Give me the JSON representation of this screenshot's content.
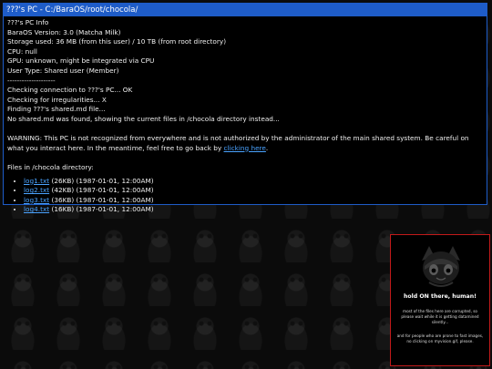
{
  "window": {
    "title": "???'s PC - C:/BaraOS/root/chocola/"
  },
  "info": {
    "heading": "???'s PC Info",
    "version": "BaraOS Version: 3.0 (Matcha Milk)",
    "storage": "Storage used: 36 MB (from this user) / 10 TB (from root directory)",
    "cpu": "CPU: null",
    "gpu": "GPU: unknown, might be integrated via CPU",
    "user_type": "User Type: Shared user (Member)",
    "separator": "--------------------"
  },
  "log": {
    "connecting": "Checking connection to ???'s PC... OK",
    "irregularities": "Checking for irregularities... X",
    "finding": "Finding ???'s shared.md file...",
    "not_found": "No shared.md was found, showing the current files in /chocola directory instead..."
  },
  "warning": {
    "text": "WARNING: This PC is not recognized from everywhere and is not authorized by the administrator of the main shared system. Be careful on what you interact here. In the meantime, feel free to go back by",
    "link_label": "clicking here",
    "suffix": "."
  },
  "files": {
    "heading": "Files in /chocola directory:",
    "items": [
      {
        "name": "log1.txt",
        "meta": "(26KB) (1987-01-01, 12:00AM)"
      },
      {
        "name": "log2.txt",
        "meta": "(42KB) (1987-01-01, 12:00AM)"
      },
      {
        "name": "log3.txt",
        "meta": "(36KB) (1987-01-01, 12:00AM)"
      },
      {
        "name": "log4.txt",
        "meta": "(16KB) (1987-01-01, 12:00AM)"
      }
    ]
  },
  "popup": {
    "title": "hold ON there, human!",
    "text1": "most of the files here are corrupted, so please wait while it is getting datamined silently...",
    "text2": "and for people who are prone to fast images, no clicking on myvision.gif, please."
  },
  "colors": {
    "accent": "#1e5cc8",
    "link": "#4aa3ff",
    "popup_border": "#c21a1a"
  }
}
